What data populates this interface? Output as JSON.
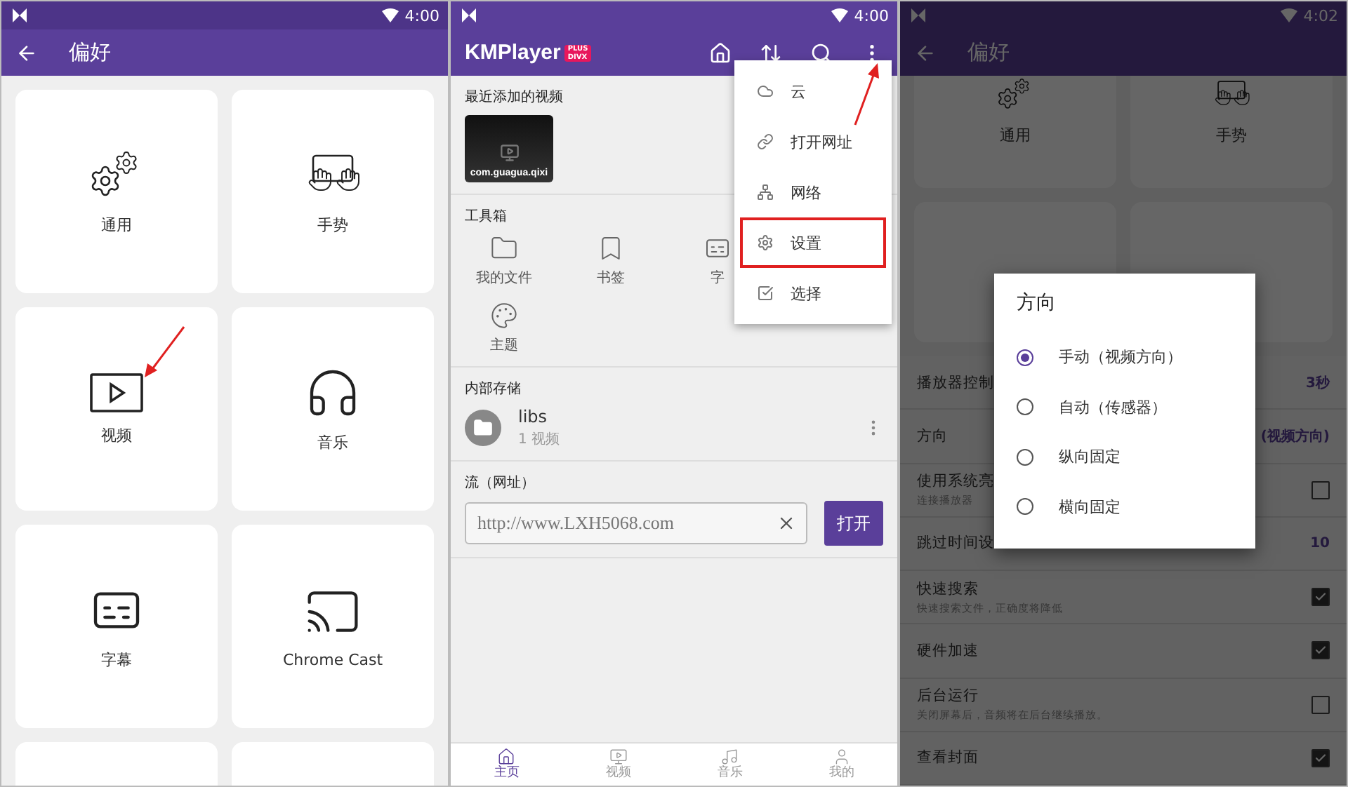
{
  "preferences_screen": {
    "status_time": "4:00",
    "title": "偏好",
    "cards": [
      {
        "label": "通用",
        "kind": "gears"
      },
      {
        "label": "手势",
        "kind": "gesture"
      },
      {
        "label": "视频",
        "kind": "video"
      },
      {
        "label": "音乐",
        "kind": "music"
      },
      {
        "label": "字幕",
        "kind": "subtitle"
      },
      {
        "label": "Chrome Cast",
        "kind": "cast"
      },
      {
        "kind": "blank"
      },
      {
        "kind": "blank"
      }
    ]
  },
  "home_screen": {
    "status_time": "4:00",
    "logo": "KMPlayer",
    "badge_top": "PLUS",
    "badge_bottom": "DIVX",
    "recent": {
      "heading": "最近添加的视频",
      "video_name": "com.guagua.qixi"
    },
    "toolbox": {
      "heading": "工具箱",
      "items": [
        {
          "label": "我的文件",
          "kind": "folder"
        },
        {
          "label": "书签",
          "kind": "bookmark"
        },
        {
          "label": "字",
          "kind": "subtitle"
        },
        {
          "label": "主题",
          "kind": "theme"
        }
      ]
    },
    "storage": {
      "heading": "内部存储",
      "folder": "libs",
      "count": "1 视频"
    },
    "stream": {
      "heading": "流（网址）",
      "value": "http://www.LXH5068.com",
      "button": "打开"
    },
    "menu": [
      {
        "label": "云",
        "kind": "cloud",
        "highlighted": false
      },
      {
        "label": "打开网址",
        "kind": "link",
        "highlighted": false
      },
      {
        "label": "网络",
        "kind": "network",
        "highlighted": false
      },
      {
        "label": "设置",
        "kind": "settings",
        "highlighted": true
      },
      {
        "label": "选择",
        "kind": "select",
        "highlighted": false
      }
    ],
    "nav": [
      {
        "label": "主页",
        "kind": "home",
        "selected": true
      },
      {
        "label": "视频",
        "kind": "video",
        "selected": false
      },
      {
        "label": "音乐",
        "kind": "music",
        "selected": false
      },
      {
        "label": "我的",
        "kind": "user",
        "selected": false
      }
    ]
  },
  "orientation_screen": {
    "status_time": "4:02",
    "title": "偏好",
    "cards": [
      {
        "label": "通用",
        "kind": "gears"
      },
      {
        "label": "手势",
        "kind": "gesture"
      }
    ],
    "settings": [
      {
        "label": "播放器控制",
        "kind": "value",
        "value": "3秒"
      },
      {
        "label": "方向",
        "kind": "value",
        "value": "(视频方向)"
      },
      {
        "label": "使用系统亮",
        "subtitle": "连接播放器",
        "kind": "checkbox",
        "checked": false
      },
      {
        "label": "跳过时间设",
        "kind": "value",
        "value": "10"
      },
      {
        "label": "快速搜索",
        "subtitle": "快速搜索文件，正确度将降低",
        "kind": "checkbox",
        "checked": true
      },
      {
        "label": "硬件加速",
        "kind": "checkbox",
        "checked": true
      },
      {
        "label": "后台运行",
        "subtitle": "关闭屏幕后，音频将在后台继续播放。",
        "kind": "checkbox",
        "checked": false
      },
      {
        "label": "查看封面",
        "kind": "checkbox",
        "checked": true
      }
    ],
    "dialog": {
      "title": "方向",
      "options": [
        {
          "label": "手动（视频方向）",
          "selected": true
        },
        {
          "label": "自动（传感器）",
          "selected": false
        },
        {
          "label": "纵向固定",
          "selected": false
        },
        {
          "label": "横向固定",
          "selected": false
        }
      ]
    }
  }
}
